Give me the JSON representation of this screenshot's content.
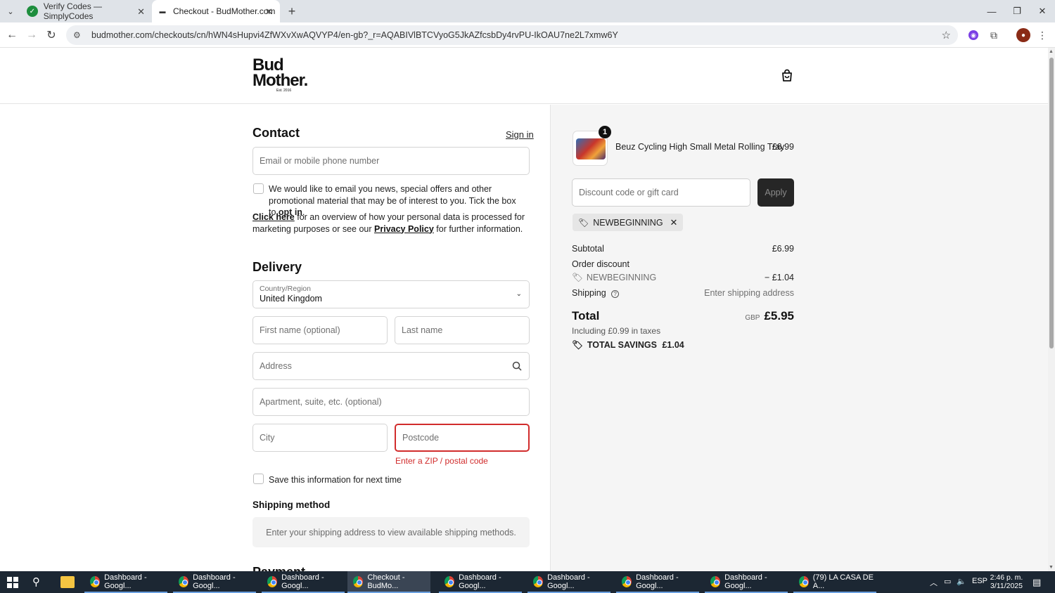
{
  "browser": {
    "tabs": [
      {
        "title": "Verify Codes — SimplyCodes",
        "favicon": "simplycodes-icon"
      },
      {
        "title": "Checkout - BudMother.com",
        "favicon": "budmother-icon",
        "active": true
      }
    ],
    "url": "budmother.com/checkouts/cn/hWN4sHupvi4ZfWXvXwAQVYP4/en-gb?_r=AQABIVlBTCVyoG5JkAZfcsbDy4rvPU-IkOAU7ne2L7xmw6Y"
  },
  "site": {
    "logo_line1": "Bud",
    "logo_line2": "Mother.",
    "logo_sub": "Est. 2016"
  },
  "contact": {
    "heading": "Contact",
    "sign_in": "Sign in",
    "email_placeholder": "Email or mobile phone number",
    "optin_text": "We would like to email you news, special offers and other promotional material that may be of interest to you. Tick the box to ",
    "optin_bold": "opt in",
    "optin_end": ".",
    "click_here": "Click here",
    "info_mid": " for an overview of how your personal data is processed for marketing purposes or see our ",
    "privacy_policy": "Privacy Policy",
    "info_end": " for further information."
  },
  "delivery": {
    "heading": "Delivery",
    "country_label": "Country/Region",
    "country_value": "United Kingdom",
    "first_name_placeholder": "First name (optional)",
    "last_name_placeholder": "Last name",
    "address_placeholder": "Address",
    "apartment_placeholder": "Apartment, suite, etc. (optional)",
    "city_placeholder": "City",
    "postcode_placeholder": "Postcode",
    "postcode_error": "Enter a ZIP / postal code",
    "save_info": "Save this information for next time"
  },
  "shipping_method": {
    "heading": "Shipping method",
    "message": "Enter your shipping address to view available shipping methods."
  },
  "payment": {
    "heading": "Payment"
  },
  "summary": {
    "product_name": "Beuz Cycling High Small Metal Rolling Tray",
    "product_price": "£6.99",
    "quantity": "1",
    "discount_placeholder": "Discount code or gift card",
    "apply": "Apply",
    "applied_code": "NEWBEGINNING",
    "subtotal_label": "Subtotal",
    "subtotal_value": "£6.99",
    "order_discount_label": "Order discount",
    "discount_code_label": "NEWBEGINNING",
    "discount_value": "− £1.04",
    "shipping_label": "Shipping",
    "shipping_value": "Enter shipping address",
    "total_label": "Total",
    "total_currency": "GBP",
    "total_value": "£5.95",
    "taxes_note": "Including £0.99 in taxes",
    "savings_label": "TOTAL SAVINGS",
    "savings_value": "£1.04"
  },
  "taskbar": {
    "apps": [
      "Dashboard - Googl...",
      "Dashboard - Googl...",
      "Dashboard - Googl...",
      "Checkout - BudMo...",
      "Dashboard - Googl...",
      "Dashboard - Googl...",
      "Dashboard - Googl...",
      "Dashboard - Googl...",
      "(79) LA CASA DE A..."
    ],
    "language": "ESP",
    "time": "2:46 p. m.",
    "date": "3/11/2025"
  },
  "colors": {
    "error": "#d12c2c",
    "summary_bg": "#f5f5f5",
    "apply_bg": "#262626"
  }
}
